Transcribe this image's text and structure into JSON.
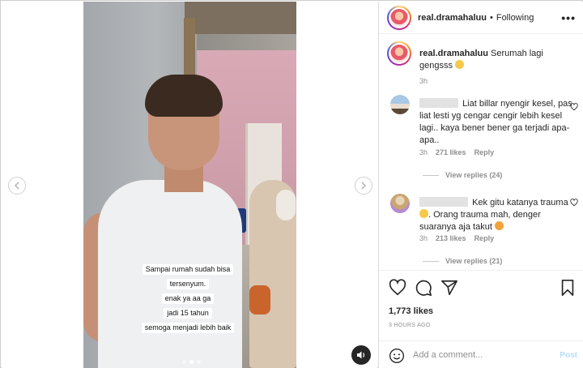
{
  "post": {
    "username": "real.dramahaluu",
    "follow_status": "Following",
    "caption_text": "Serumah lagi gengsss",
    "caption_time": "3h"
  },
  "video": {
    "caption_lines": [
      "Sampai rumah sudah bisa",
      "tersenyum.",
      "enak ya aa ga",
      "jadi 15 tahun",
      "semoga menjadi lebih baik"
    ],
    "slide_count": 3,
    "active_slide": 2
  },
  "comments": [
    {
      "text": "Liat billar nyengir kesel, pas liat lesti yg cengar cengir lebih kesel lagi.. kaya bener bener ga terjadi apa-apa..",
      "time": "3h",
      "likes": "271 likes",
      "reply_label": "Reply",
      "view_replies": "View replies (24)"
    },
    {
      "text_a": "Kek gitu katanya trauma",
      "text_b": ". Orang trauma mah, denger suaranya aja takut",
      "time": "3h",
      "likes": "213 likes",
      "reply_label": "Reply",
      "view_replies": "View replies (21)"
    }
  ],
  "stats": {
    "likes": "1,773 likes",
    "time_ago": "3 HOURS AGO"
  },
  "comment_box": {
    "placeholder": "Add a comment...",
    "post_label": "Post"
  },
  "icons": {
    "more": "more-options-icon",
    "heart": "heart-icon",
    "comment": "comment-icon",
    "share": "share-icon",
    "save": "bookmark-icon",
    "emoji": "smiley-icon",
    "mute": "speaker-icon"
  },
  "colors": {
    "link_blue_disabled": "#b2dffc",
    "secondary_text": "#8e8e8e",
    "primary_text": "#262626"
  }
}
